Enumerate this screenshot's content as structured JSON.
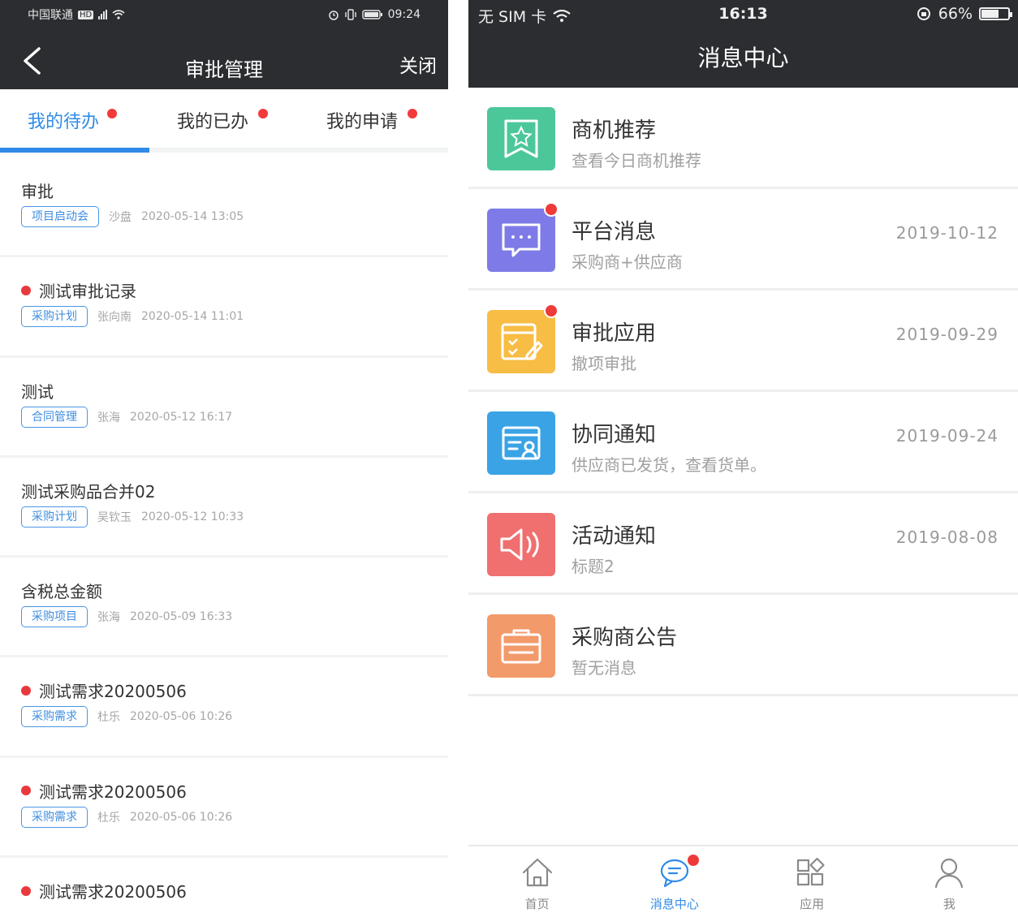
{
  "left": {
    "status": {
      "carrier": "中国联通",
      "net": "HD",
      "time": "09:24"
    },
    "nav": {
      "title": "审批管理",
      "close": "关闭"
    },
    "tabs": [
      {
        "label": "我的待办",
        "active": true
      },
      {
        "label": "我的已办",
        "active": false
      },
      {
        "label": "我的申请",
        "active": false
      }
    ],
    "items": [
      {
        "title": "审批",
        "tag": "项目启动会",
        "person": "沙盘",
        "time": "2020-05-14 13:05",
        "unread": false
      },
      {
        "title": "测试审批记录",
        "tag": "采购计划",
        "person": "张向南",
        "time": "2020-05-14 11:01",
        "unread": true
      },
      {
        "title": "测试",
        "tag": "合同管理",
        "person": "张海",
        "time": "2020-05-12 16:17",
        "unread": false
      },
      {
        "title": "测试采购品合并02",
        "tag": "采购计划",
        "person": "吴钦玉",
        "time": "2020-05-12 10:33",
        "unread": false
      },
      {
        "title": "含税总金额",
        "tag": "采购项目",
        "person": "张海",
        "time": "2020-05-09 16:33",
        "unread": false
      },
      {
        "title": "测试需求20200506",
        "tag": "采购需求",
        "person": "杜乐",
        "time": "2020-05-06 10:26",
        "unread": true
      },
      {
        "title": "测试需求20200506",
        "tag": "采购需求",
        "person": "杜乐",
        "time": "2020-05-06 10:26",
        "unread": true
      },
      {
        "title": "测试需求20200506",
        "tag": "",
        "person": "",
        "time": "",
        "unread": true
      }
    ]
  },
  "right": {
    "status": {
      "carrier": "无 SIM 卡",
      "time": "16:13",
      "battery": "66%",
      "battery_level": 0.66
    },
    "nav": {
      "title": "消息中心"
    },
    "items": [
      {
        "name": "商机推荐",
        "sub": "查看今日商机推荐",
        "date": "",
        "icon": "star-bookmark-icon",
        "color": "#4cc79a",
        "badge": false
      },
      {
        "name": "平台消息",
        "sub": "采购商+供应商",
        "date": "2019-10-12",
        "icon": "chat-bubble-icon",
        "color": "#7e7be8",
        "badge": true
      },
      {
        "name": "审批应用",
        "sub": "撤项审批",
        "date": "2019-09-29",
        "icon": "approval-edit-icon",
        "color": "#f7bd45",
        "badge": true
      },
      {
        "name": "协同通知",
        "sub": "供应商已发货，查看货单。",
        "date": "2019-09-24",
        "icon": "contact-card-icon",
        "color": "#3aa3e6",
        "badge": false
      },
      {
        "name": "活动通知",
        "sub": "标题2",
        "date": "2019-08-08",
        "icon": "speaker-icon",
        "color": "#f06f6f",
        "badge": false
      },
      {
        "name": "采购商公告",
        "sub": "暂无消息",
        "date": "",
        "icon": "briefcase-icon",
        "color": "#f39a6b",
        "badge": false
      }
    ],
    "tabbar": [
      {
        "label": "首页",
        "icon": "home-icon",
        "active": false,
        "badge": false
      },
      {
        "label": "消息中心",
        "icon": "message-icon",
        "active": true,
        "badge": true
      },
      {
        "label": "应用",
        "icon": "apps-icon",
        "active": false,
        "badge": false
      },
      {
        "label": "我",
        "icon": "user-icon",
        "active": false,
        "badge": false
      }
    ]
  }
}
